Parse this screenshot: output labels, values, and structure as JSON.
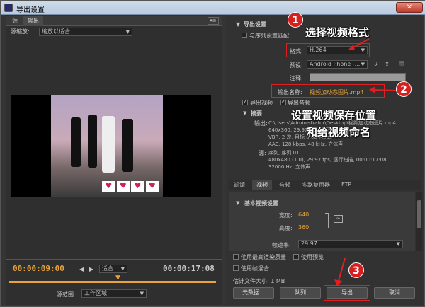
{
  "window": {
    "title": "导出设置",
    "close": "✕"
  },
  "left_tabs": [
    "源",
    "输出"
  ],
  "source_scaling": {
    "label": "源缩放:",
    "value": "缩放以适合"
  },
  "timecode_in": "00:00:09:00",
  "timecode_out": "00:00:17:08",
  "fit": "适合",
  "source_range": {
    "label": "源范围:",
    "value": "工作区域"
  },
  "export_settings": {
    "header": "导出设置",
    "match_sequence": "与序列设置匹配",
    "format_label": "格式:",
    "format_value": "H.264",
    "preset_label": "预设:",
    "preset_value": "Android Phone -...",
    "notes_label": "注释:",
    "output_name_label": "输出名称:",
    "output_name_value": "视频加动态图片.mp4",
    "export_video": "导出视频",
    "export_audio": "导出音频"
  },
  "summary": {
    "header": "摘要",
    "output_label": "输出:",
    "output_lines": [
      "C:\\Users\\Administrator\\Desktop\\视频加动态图片.mp4",
      "640x360, 29.97 fps, 逐行",
      "VBR, 2 次, 目标 0.60 Mbps",
      "AAC, 128 kbps, 48 kHz, 立体声"
    ],
    "source_label": "源:",
    "source_lines": [
      "序列, 序列 01",
      "480x480 (1.0), 29.97 fps, 逐行扫描, 00:00:17:08",
      "32000 Hz, 立体声"
    ]
  },
  "settings_tabs": [
    "滤镜",
    "视频",
    "音频",
    "多路复用器",
    "FTP"
  ],
  "basic_video": {
    "header": "基本视频设置",
    "width_label": "宽度:",
    "width_value": "640",
    "height_label": "高度:",
    "height_value": "360",
    "fps_label": "帧速率:",
    "fps_value": "29.97"
  },
  "options": {
    "max_render": "使用最高渲染质量",
    "use_preview": "使用预览",
    "frame_blend": "使用帧混合",
    "est_size": "估计文件大小: 1 MB"
  },
  "buttons": {
    "metadata": "元数据...",
    "queue": "队列",
    "export": "导出",
    "cancel": "取消"
  },
  "annotations": {
    "n1": "1",
    "t1": "选择视频格式",
    "n2": "2",
    "t2": "设置视频保存位置",
    "t2b": "和给视频命名",
    "n3": "3"
  }
}
